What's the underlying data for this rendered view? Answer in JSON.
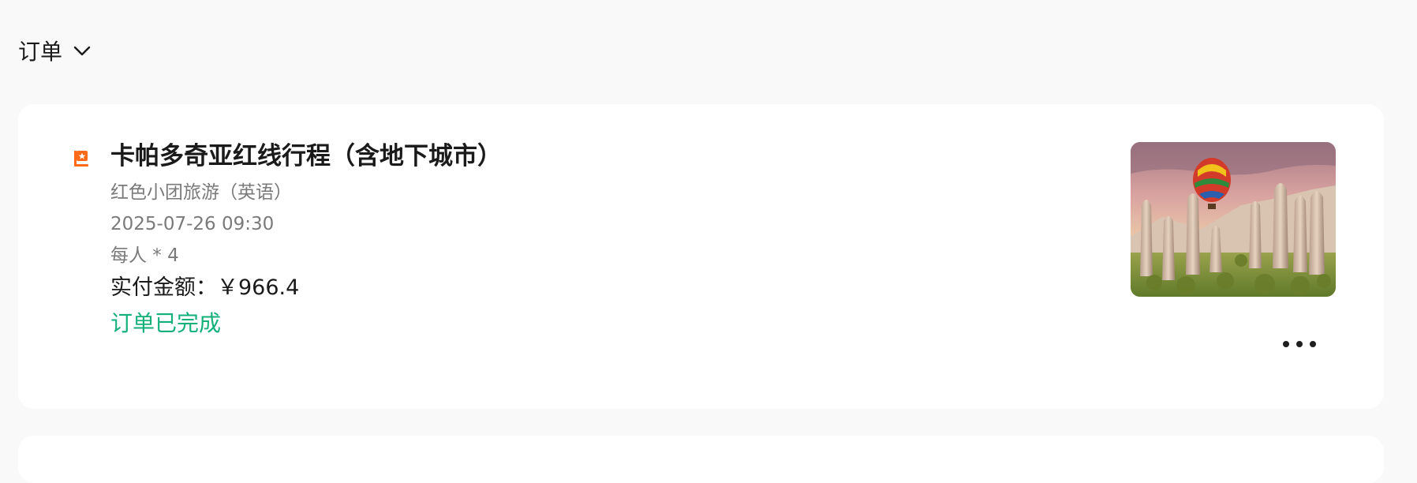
{
  "header": {
    "title": "订单",
    "dropdown_icon": "chevron-down-icon"
  },
  "order": {
    "category_icon": "tour-flag-icon",
    "title": "卡帕多奇亚红线行程（含地下城市）",
    "package": "红色小团旅游（英语）",
    "datetime": "2025-07-26 09:30",
    "quantity": "每人 * 4",
    "price_label": "实付金额：",
    "price_value": "￥966.4",
    "status": "订单已完成",
    "status_color": "#14b07a",
    "thumbnail": "cappadocia-hot-air-balloon-photo",
    "more_icon": "more-dots-icon"
  }
}
